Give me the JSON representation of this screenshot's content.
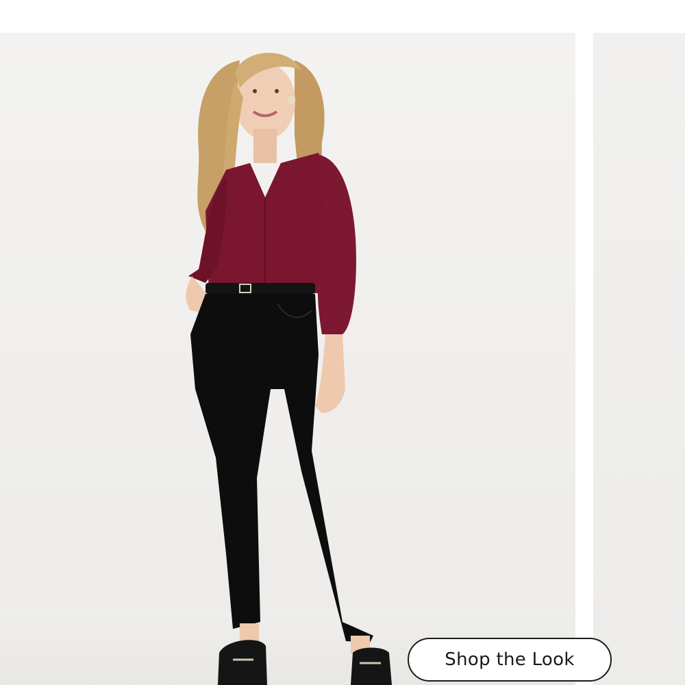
{
  "product_image": {
    "icon": "model-photo",
    "top_color": "#7a1630",
    "pants_color": "#0d0d0d",
    "hair_color": "#c9a36a"
  },
  "cta": {
    "label": "Shop the Look"
  }
}
